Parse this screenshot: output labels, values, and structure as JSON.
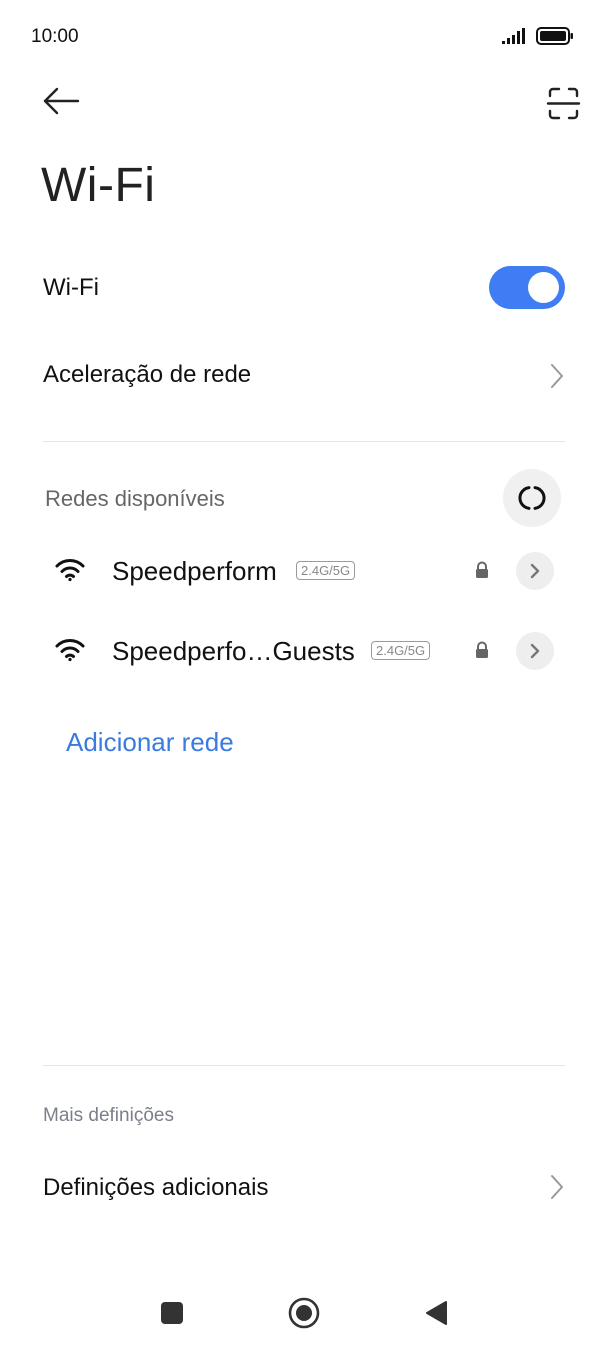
{
  "status_bar": {
    "time": "10:00"
  },
  "header": {
    "title": "Wi-Fi",
    "back_icon": "arrow-left-icon",
    "scan_icon": "qr-scan-icon"
  },
  "wifi_toggle": {
    "label": "Wi-Fi",
    "enabled": true,
    "accent_color": "#3f7df4"
  },
  "network_acceleration": {
    "label": "Aceleração de rede"
  },
  "available_networks": {
    "title": "Redes disponíveis",
    "networks": [
      {
        "name": "Speedperform",
        "band": "2.4G/5G",
        "secured": true
      },
      {
        "name": "Speedperfo…Guests",
        "band": "2.4G/5G",
        "secured": true
      }
    ],
    "add_network_label": "Adicionar rede",
    "link_color": "#3a7be0"
  },
  "more_settings": {
    "title": "Mais definições",
    "items": [
      {
        "label": "Definições adicionais"
      }
    ]
  },
  "nav_bar": {
    "recents_icon": "square-icon",
    "home_icon": "circle-home-icon",
    "back_icon": "triangle-back-icon"
  }
}
